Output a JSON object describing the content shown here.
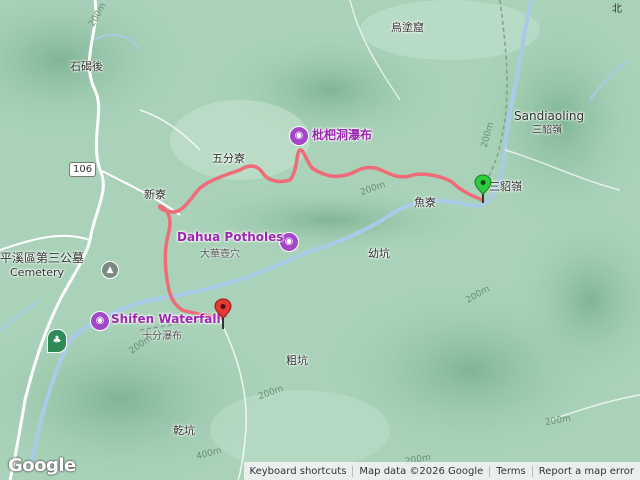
{
  "map": {
    "places": [
      {
        "text": "石碣後"
      },
      {
        "text": "烏塗窟"
      },
      {
        "text": "五分寮"
      },
      {
        "text": "新寮"
      },
      {
        "text": "魚寮"
      },
      {
        "text": "幼坑"
      },
      {
        "text": "粗坑"
      },
      {
        "text": "乾坑"
      },
      {
        "text": "三貂嶺"
      },
      {
        "text": "平溪區第三公墓"
      },
      {
        "text": "Cemetery"
      },
      {
        "text": "Sandiaoling"
      }
    ],
    "pois": [
      {
        "name": "枇杷洞瀑布",
        "icon": "camera-icon"
      },
      {
        "name": "Dahua Potholes",
        "sub": "大華壺穴",
        "icon": "camera-icon"
      },
      {
        "name": "Shifen Waterfall",
        "sub": "十分瀑布",
        "icon": "camera-icon"
      }
    ],
    "road_shield": "106",
    "contours": [
      "200m",
      "200m",
      "200m",
      "200m",
      "200m",
      "200m",
      "200m",
      "400m",
      "200m"
    ],
    "route_color": "#f06b78",
    "start_marker_color": "#2ecc40",
    "end_marker_color": "#e53935",
    "top_right_label": "北"
  },
  "footer": {
    "logo": "Google",
    "keyboard": "Keyboard shortcuts",
    "mapdata": "Map data ©2026 Google",
    "terms": "Terms",
    "report": "Report a map error"
  }
}
